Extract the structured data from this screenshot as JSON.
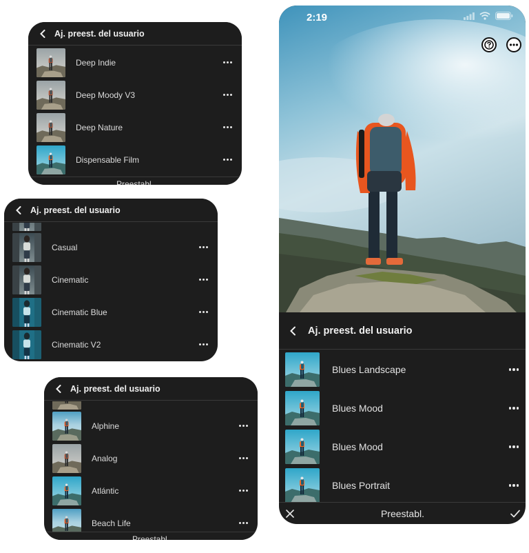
{
  "card1": {
    "header_title": "Aj. preest. del usuario",
    "items": [
      {
        "label": "Deep Indie"
      },
      {
        "label": "Deep Moody V3"
      },
      {
        "label": "Deep Nature"
      },
      {
        "label": "Dispensable Film"
      }
    ],
    "footer_label": "Preestabl."
  },
  "card2": {
    "header_title": "Aj. preest. del usuario",
    "items": [
      {
        "label": "Casual"
      },
      {
        "label": "Cinematic"
      },
      {
        "label": "Cinematic Blue"
      },
      {
        "label": "Cinematic V2"
      }
    ]
  },
  "card3": {
    "header_title": "Aj. preest. del usuario",
    "items": [
      {
        "label": "Alphine"
      },
      {
        "label": "Analog"
      },
      {
        "label": "Atlántic"
      },
      {
        "label": "Beach Life"
      }
    ],
    "footer_label": "Preestabl."
  },
  "phone": {
    "status_time": "2:19",
    "header_title": "Aj. preest. del usuario",
    "items": [
      {
        "label": "Blues Landscape"
      },
      {
        "label": "Blues Mood"
      },
      {
        "label": "Blues Mood"
      },
      {
        "label": "Blues Portrait"
      }
    ],
    "footer_label": "Preestabl."
  },
  "icons": {
    "back": "chevron-left-icon",
    "more": "more-horizontal-icon",
    "help": "help-circle-icon",
    "options": "more-circle-icon",
    "close": "close-icon",
    "confirm": "checkmark-icon"
  },
  "colors": {
    "panel_bg": "#1d1d1d",
    "divider": "#3a3a3a",
    "text": "#e2e2e2",
    "sky_top": "#7fb6cf",
    "jacket": "#e8561f"
  }
}
